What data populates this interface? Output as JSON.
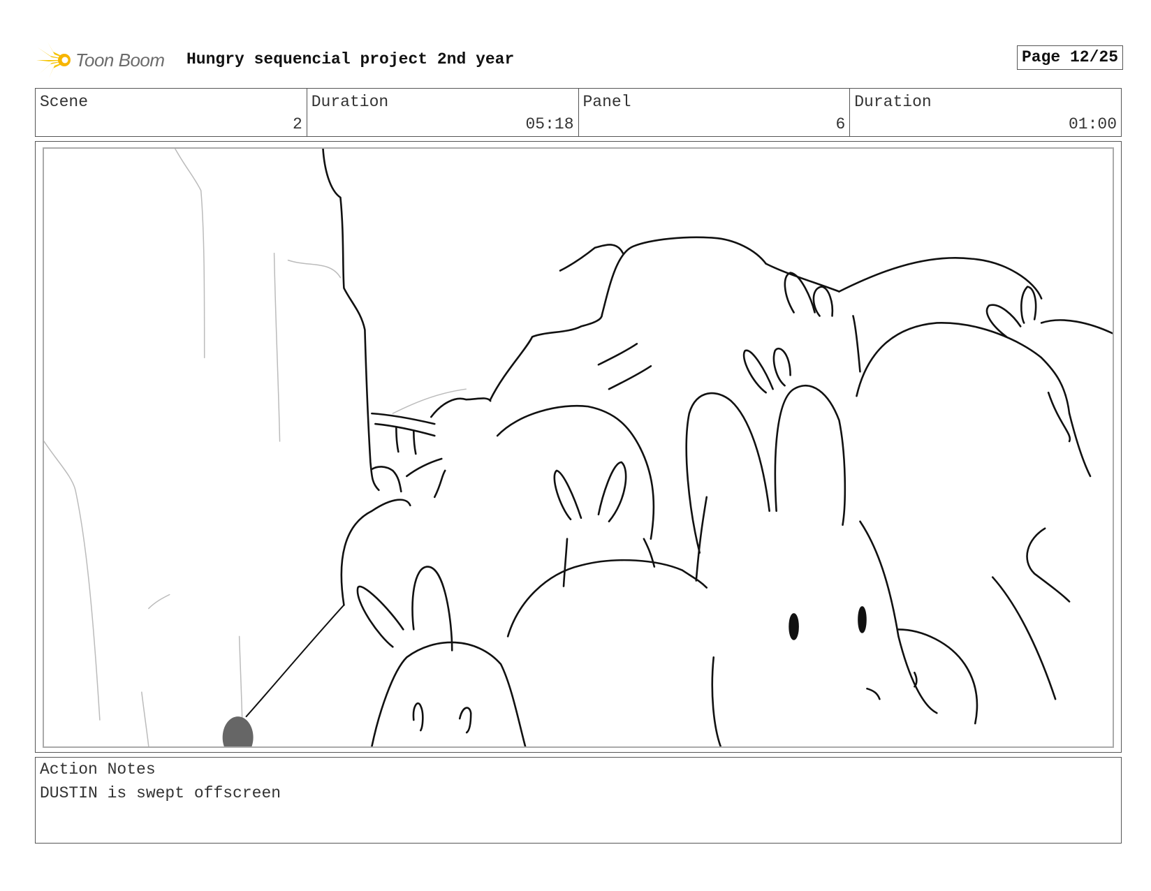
{
  "header": {
    "logo_text": "Toon Boom",
    "project_title": "Hungry sequencial project 2nd year",
    "page_label": "Page 12/25"
  },
  "info": {
    "scene_label": "Scene",
    "scene_value": "2",
    "scene_duration_label": "Duration",
    "scene_duration_value": "05:18",
    "panel_label": "Panel",
    "panel_value": "6",
    "panel_duration_label": "Duration",
    "panel_duration_value": "01:00"
  },
  "notes": {
    "label": "Action Notes",
    "text": "DUSTIN is swept offscreen"
  },
  "colors": {
    "logo_accent": "#f5c400",
    "border": "#555555",
    "sketch_line": "#111111"
  }
}
